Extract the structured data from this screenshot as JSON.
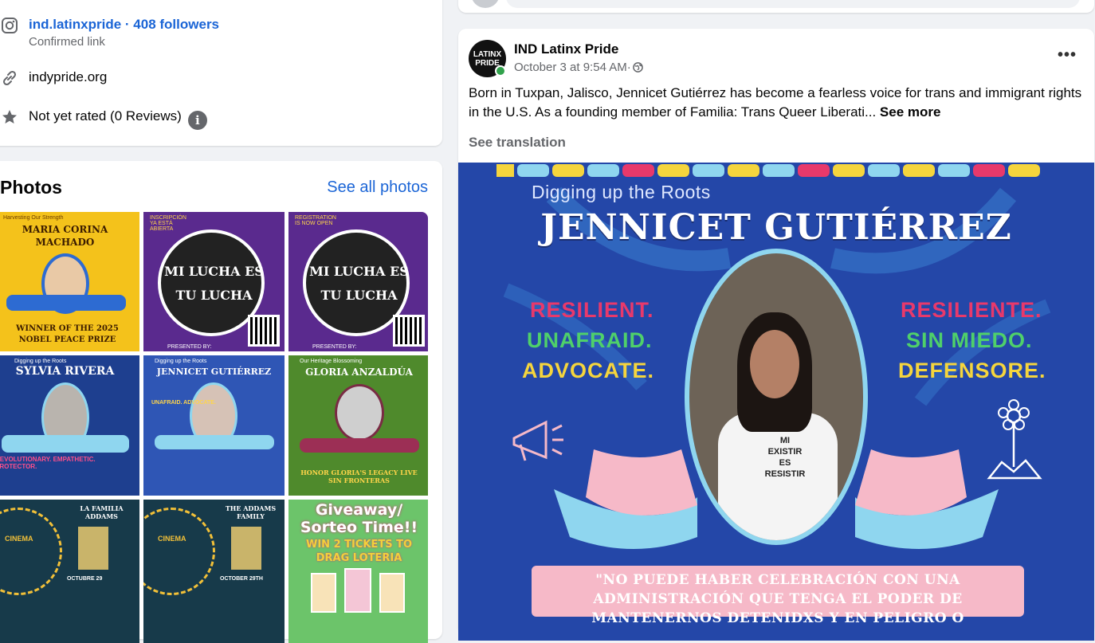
{
  "intro": {
    "instagram": {
      "handle": "ind.latinxpride",
      "separator": " · ",
      "followers": "408 followers",
      "sub": "Confirmed link"
    },
    "website": "indypride.org",
    "rating": "Not yet rated (0 Reviews)",
    "info_glyph": "i"
  },
  "photos": {
    "title": "Photos",
    "see_all": "See all photos",
    "tiles": [
      {
        "small": "Harvesting Our Strength",
        "name": "MARIA CORINA MACHADO",
        "caption": "WINNER OF THE 2025 NOBEL PEACE PRIZE",
        "bg": "#f4c21b"
      },
      {
        "small": "INSCRIPCIÓN YA ESTÁ ABIERTA",
        "name": "MI LUCHA ES TU LUCHA",
        "caption": "PRESENTED BY:",
        "bg": "#5a2a8e"
      },
      {
        "small": "REGISTRATION IS NOW OPEN",
        "name": "MI LUCHA ES TU LUCHA",
        "caption": "PRESENTED BY:",
        "bg": "#5a2a8e"
      },
      {
        "small": "Digging up the Roots",
        "name": "SYLVIA RIVERA",
        "caption": "REVOLUTIONARY. EMPATHETIC. PROTECTOR.",
        "bg": "#1e3f8f"
      },
      {
        "small": "Digging up the Roots",
        "name": "JENNICET GUTIÉRREZ",
        "caption": "UNAFRAID. ADVOCATE.",
        "bg": "#2f56b5"
      },
      {
        "small": "Our Heritage Blossoming",
        "name": "GLORIA ANZALDÚA",
        "caption": "HONOR GLORIA'S LEGACY LIVE SIN FRONTERAS",
        "bg": "#4f8a2c"
      },
      {
        "small": "CINEMA",
        "name": "LA FAMILIA ADDAMS",
        "caption": "OCTUBRE 29",
        "bg": "#173a4a"
      },
      {
        "small": "CINEMA",
        "name": "THE ADDAMS FAMILY",
        "caption": "OCTOBER 29TH",
        "bg": "#173a4a"
      },
      {
        "small": "",
        "name": "Giveaway/ Sorteo Time!!",
        "caption": "WIN 2 TICKETS TO DRAG LOTERIA",
        "bg": "#6cc46a"
      }
    ]
  },
  "post": {
    "avatar_line1": "LATINX",
    "avatar_line2": "PRIDE",
    "author": "IND Latinx Pride",
    "date": "October 3 at 9:54 AM",
    "meta_separator": " · ",
    "more": "•••",
    "body": "Born in Tuxpan, Jalisco, Jennicet Gutiérrez has become a fearless voice for trans and immigrant rights in the U.S. As a founding member of Familia: Trans Queer Liberati...",
    "see_more": "See more",
    "see_translation": "See translation",
    "image": {
      "subtitle": "Digging up the Roots",
      "title": "JENNICET GUTIÉRREZ",
      "left_words": [
        "RESILIENT.",
        "UNAFRAID.",
        "ADVOCATE."
      ],
      "right_words": [
        "RESILIENTE.",
        "SIN MIEDO.",
        "DEFENSORE."
      ],
      "shirt": [
        "MI",
        "EXISTIR",
        "ES",
        "RESISTIR"
      ],
      "quote": "\"NO PUEDE HABER CELEBRACIÓN CON UNA ADMINISTRACIÓN QUE TENGA EL PODER DE MANTENERNOS DETENIDXS Y EN PELIGRO O",
      "colors": {
        "resilient": "#e8396b",
        "unafraid": "#4fd06a",
        "advocate": "#f5d53d"
      }
    }
  },
  "colors": {
    "link": "#1b65d6",
    "page_bg": "#f0f2f5",
    "image_bg": "#2447a8"
  }
}
